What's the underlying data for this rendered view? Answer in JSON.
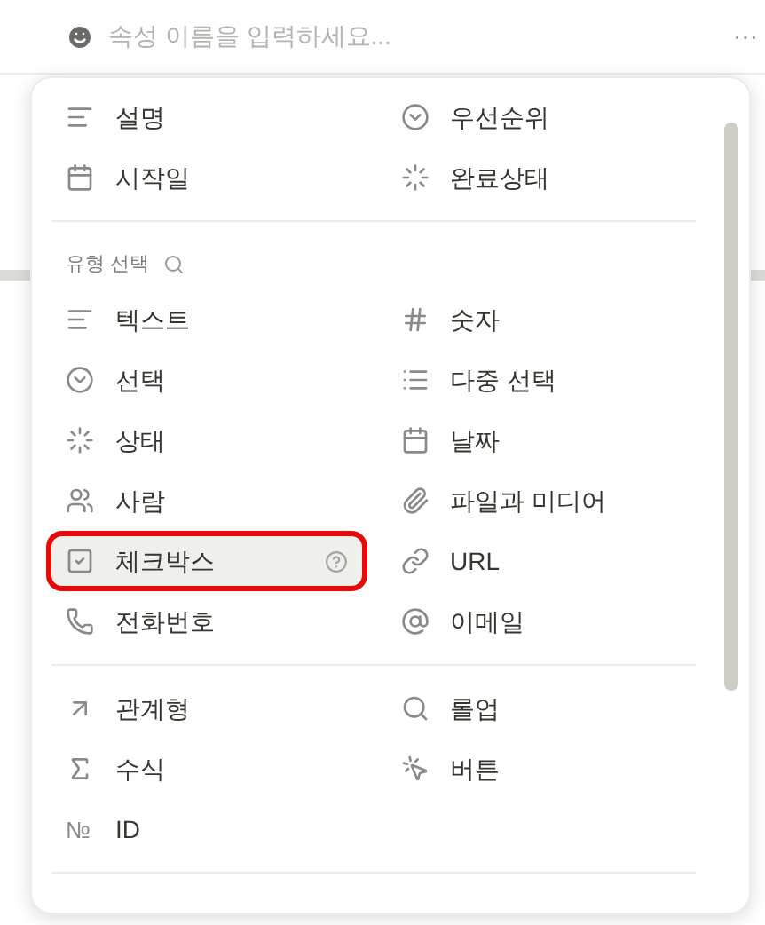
{
  "name_field": {
    "placeholder": "속성 이름을 입력하세요..."
  },
  "more": "···",
  "menu": {
    "sections": [
      {
        "items": [
          {
            "label": "설명",
            "kind": "text",
            "selected": false
          },
          {
            "label": "우선순위",
            "kind": "select",
            "selected": false
          },
          {
            "label": "시작일",
            "kind": "date",
            "selected": false
          },
          {
            "label": "완료상태",
            "kind": "status",
            "selected": false
          }
        ]
      },
      {
        "header": "유형 선택",
        "items": [
          {
            "label": "텍스트",
            "kind": "text",
            "selected": false
          },
          {
            "label": "숫자",
            "kind": "number",
            "selected": false
          },
          {
            "label": "선택",
            "kind": "select",
            "selected": false
          },
          {
            "label": "다중 선택",
            "kind": "multiselect",
            "selected": false
          },
          {
            "label": "상태",
            "kind": "status",
            "selected": false
          },
          {
            "label": "날짜",
            "kind": "date",
            "selected": false
          },
          {
            "label": "사람",
            "kind": "person",
            "selected": false
          },
          {
            "label": "파일과 미디어",
            "kind": "file",
            "selected": false
          },
          {
            "label": "체크박스",
            "kind": "checkbox",
            "selected": true
          },
          {
            "label": "URL",
            "kind": "url",
            "selected": false
          },
          {
            "label": "전화번호",
            "kind": "phone",
            "selected": false
          },
          {
            "label": "이메일",
            "kind": "email",
            "selected": false
          }
        ]
      },
      {
        "items": [
          {
            "label": "관계형",
            "kind": "relation",
            "selected": false
          },
          {
            "label": "롤업",
            "kind": "rollup",
            "selected": false
          },
          {
            "label": "수식",
            "kind": "formula",
            "selected": false
          },
          {
            "label": "버튼",
            "kind": "button",
            "selected": false
          },
          {
            "label": "ID",
            "kind": "id",
            "icon_text": "№",
            "selected": false
          }
        ]
      }
    ]
  }
}
